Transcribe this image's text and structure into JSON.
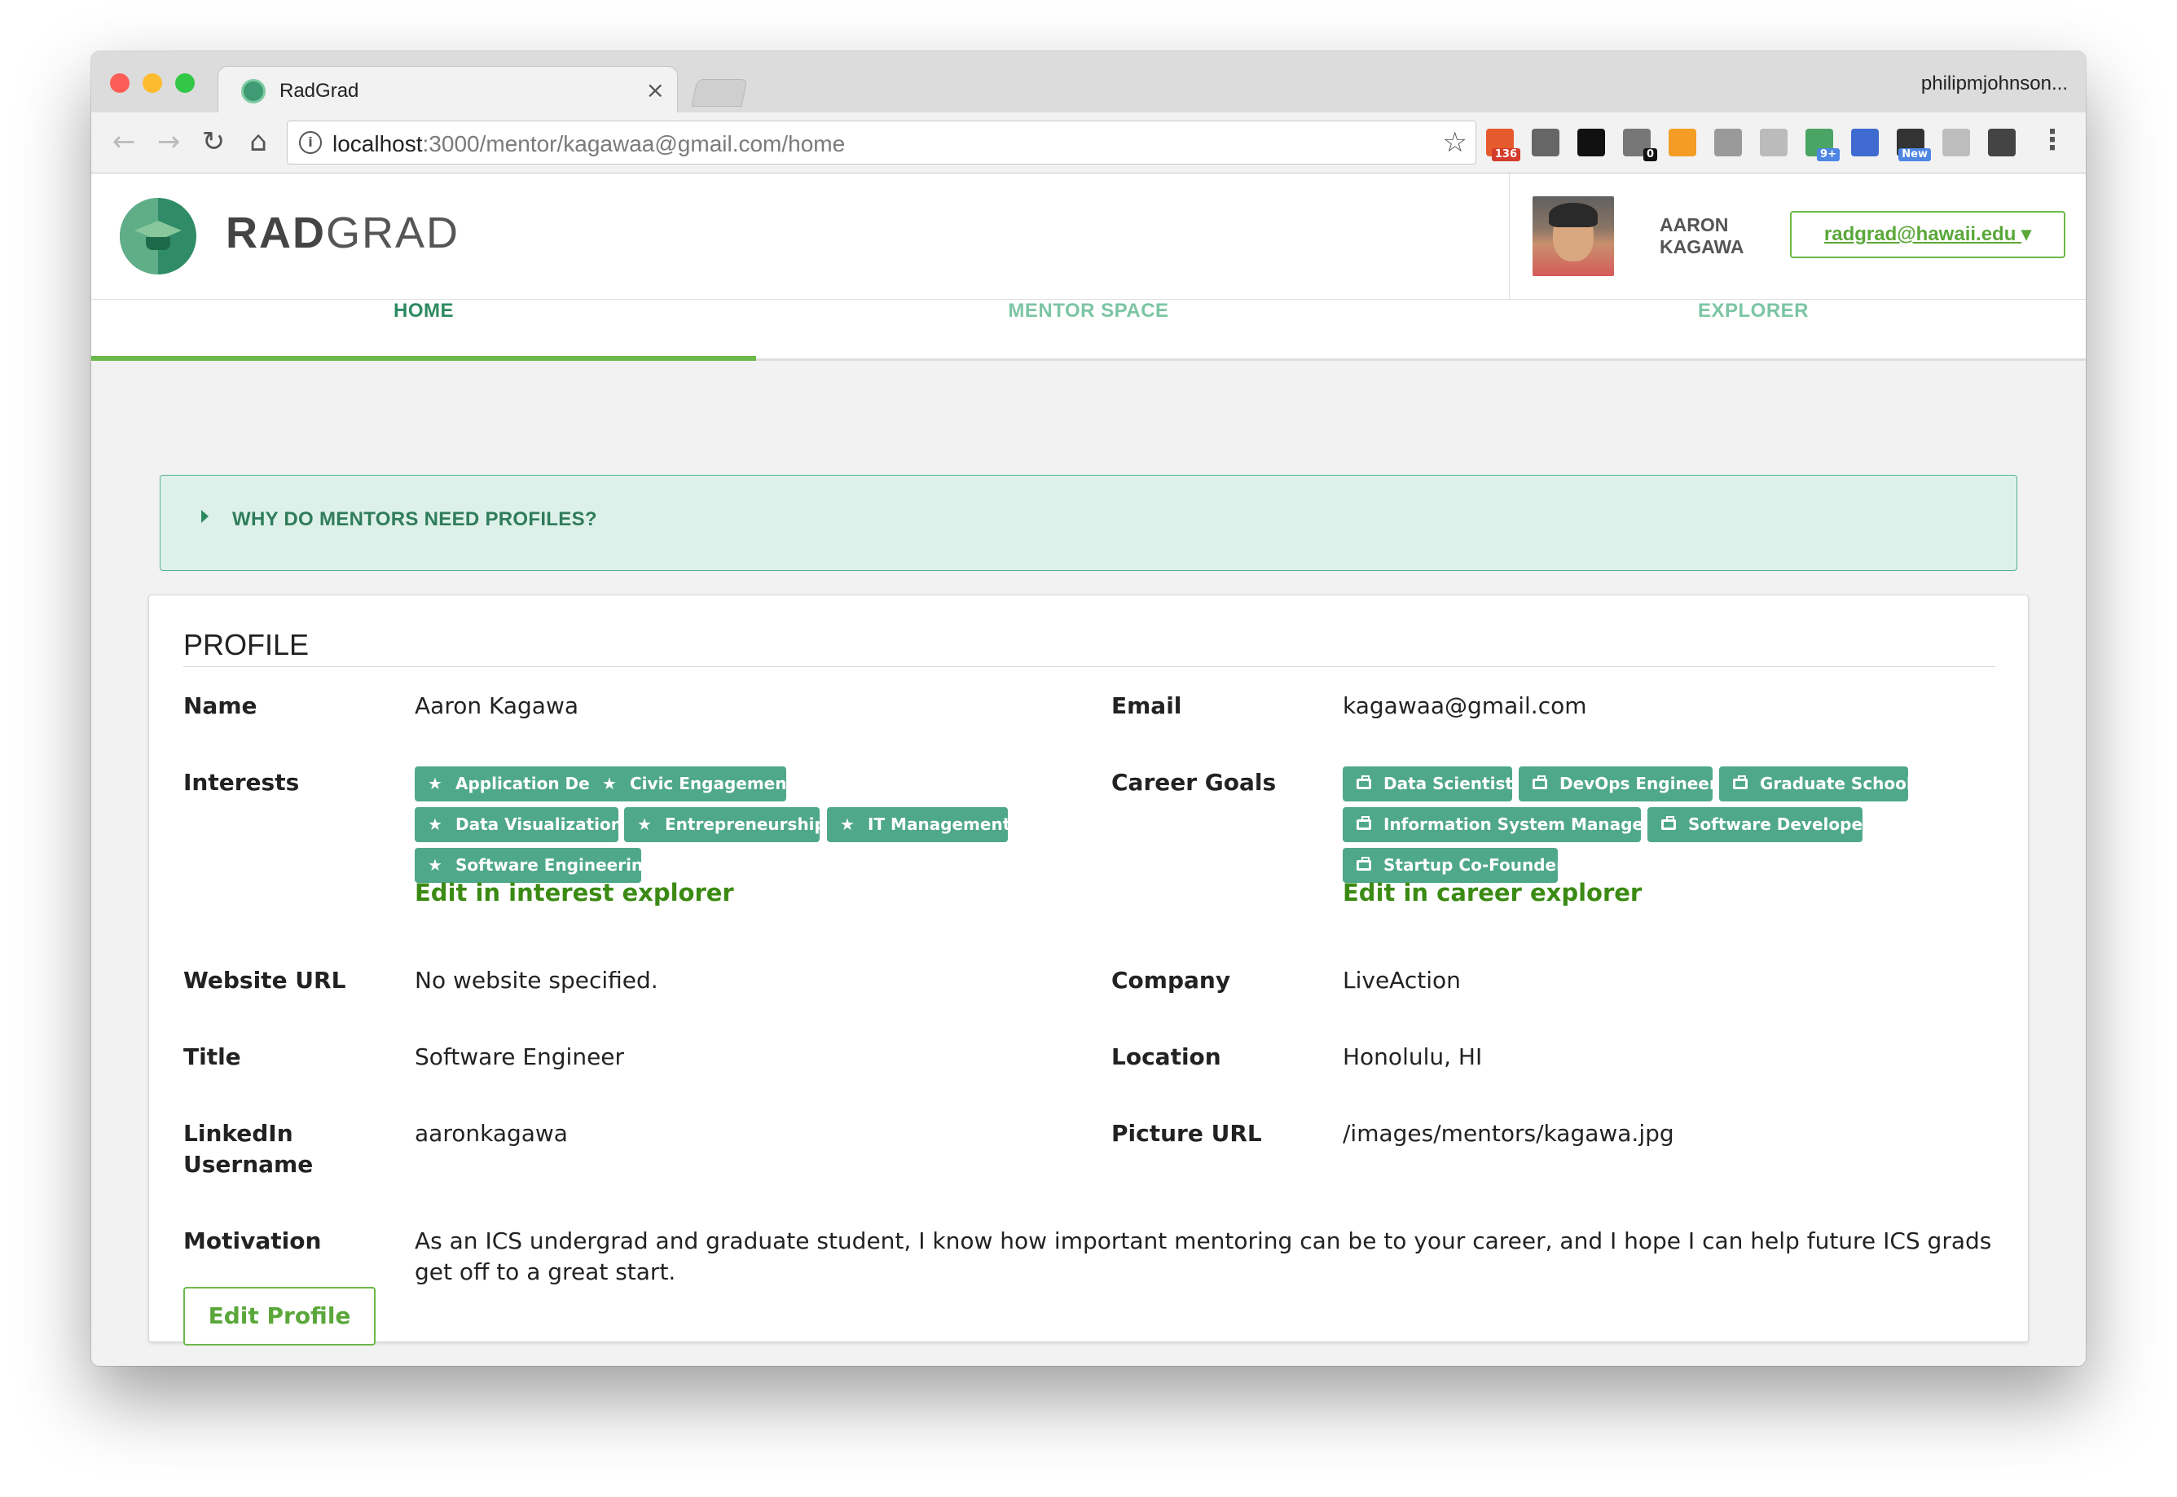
{
  "browser": {
    "tab_title": "RadGrad",
    "tab_close": "×",
    "profile_name": "philipmjohnson...",
    "url_host": "localhost",
    "url_rest": ":3000/mentor/kagawaa@gmail.com/home",
    "extensions": [
      {
        "name": "rss-icon",
        "color": "#e55b2d",
        "badge": "136",
        "badge_color": "#d43b2a"
      },
      {
        "name": "info-icon",
        "color": "#666666",
        "badge": ""
      },
      {
        "name": "jetbrains-icon",
        "color": "#111111",
        "badge": ""
      },
      {
        "name": "lock-icon",
        "color": "#777777",
        "badge": "0",
        "badge_color": "#111111"
      },
      {
        "name": "chart-icon",
        "color": "#f39c26",
        "badge": ""
      },
      {
        "name": "link-icon",
        "color": "#9a9a9a",
        "badge": ""
      },
      {
        "name": "drive-icon",
        "color": "#bbbbbb",
        "badge": ""
      },
      {
        "name": "hangouts-icon",
        "color": "#4aa564",
        "badge": "9+",
        "badge_color": "#4e86e4"
      },
      {
        "name": "eyedropper-icon",
        "color": "#3f6ad0",
        "badge": ""
      },
      {
        "name": "new-icon",
        "color": "#333333",
        "badge": "New",
        "badge_color": "#4e86e4"
      },
      {
        "name": "ghost-icon",
        "color": "#bdbdbd",
        "badge": ""
      },
      {
        "name": "refresh-ext-icon",
        "color": "#444444",
        "badge": ""
      }
    ]
  },
  "app": {
    "logo_bold": "RAD",
    "logo_rest": "GRAD",
    "user_first": "AARON",
    "user_last": "KAGAWA",
    "user_email": "radgrad@hawaii.edu",
    "user_caret": "▾",
    "nav": [
      "HOME",
      "MENTOR SPACE",
      "EXPLORER"
    ],
    "why_text": "WHY DO MENTORS NEED PROFILES?"
  },
  "profile": {
    "title": "PROFILE",
    "name_label": "Name",
    "name": "Aaron Kagawa",
    "email_label": "Email",
    "email": "kagawaa@gmail.com",
    "interests_label": "Interests",
    "interests": [
      "Application Development",
      "Civic Engagement",
      "Data Visualization",
      "Entrepreneurship",
      "IT Management",
      "Software Engineering"
    ],
    "interest_edit": "Edit in interest explorer",
    "career_label": "Career Goals",
    "careers": [
      "Data Scientist",
      "DevOps Engineer",
      "Graduate School",
      "Information System Manager",
      "Software Developer",
      "Startup Co-Founder"
    ],
    "career_edit": "Edit in career explorer",
    "website_label": "Website URL",
    "website": "No website specified.",
    "company_label": "Company",
    "company": "LiveAction",
    "title_label": "Title",
    "job_title": "Software Engineer",
    "location_label": "Location",
    "location": "Honolulu, HI",
    "linkedin_label_1": "LinkedIn",
    "linkedin_label_2": "Username",
    "linkedin": "aaronkagawa",
    "picture_label": "Picture URL",
    "picture": "/images/mentors/kagawa.jpg",
    "motivation_label": "Motivation",
    "motivation": "As an ICS undergrad and graduate student, I know how important mentoring can be to your career, and I hope I can help future ICS grads get off to a great start.",
    "edit_button": "Edit Profile"
  }
}
